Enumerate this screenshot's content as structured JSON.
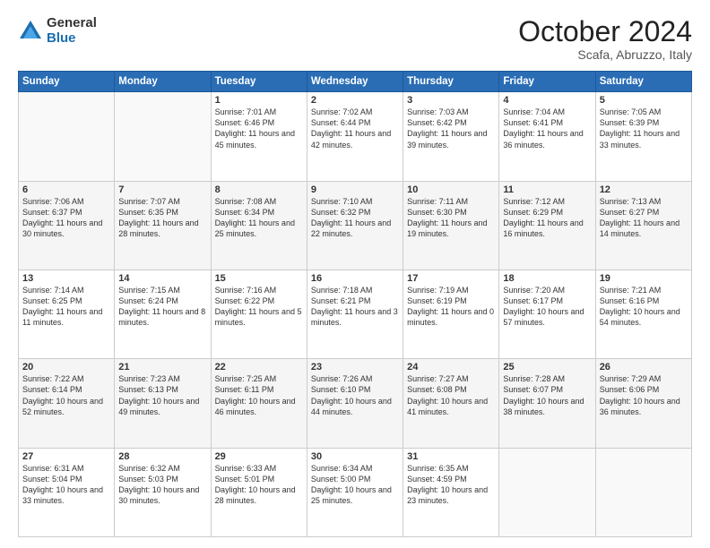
{
  "header": {
    "logo_general": "General",
    "logo_blue": "Blue",
    "month": "October 2024",
    "location": "Scafa, Abruzzo, Italy"
  },
  "weekdays": [
    "Sunday",
    "Monday",
    "Tuesday",
    "Wednesday",
    "Thursday",
    "Friday",
    "Saturday"
  ],
  "weeks": [
    [
      {
        "day": "",
        "info": ""
      },
      {
        "day": "",
        "info": ""
      },
      {
        "day": "1",
        "info": "Sunrise: 7:01 AM\nSunset: 6:46 PM\nDaylight: 11 hours and 45 minutes."
      },
      {
        "day": "2",
        "info": "Sunrise: 7:02 AM\nSunset: 6:44 PM\nDaylight: 11 hours and 42 minutes."
      },
      {
        "day": "3",
        "info": "Sunrise: 7:03 AM\nSunset: 6:42 PM\nDaylight: 11 hours and 39 minutes."
      },
      {
        "day": "4",
        "info": "Sunrise: 7:04 AM\nSunset: 6:41 PM\nDaylight: 11 hours and 36 minutes."
      },
      {
        "day": "5",
        "info": "Sunrise: 7:05 AM\nSunset: 6:39 PM\nDaylight: 11 hours and 33 minutes."
      }
    ],
    [
      {
        "day": "6",
        "info": "Sunrise: 7:06 AM\nSunset: 6:37 PM\nDaylight: 11 hours and 30 minutes."
      },
      {
        "day": "7",
        "info": "Sunrise: 7:07 AM\nSunset: 6:35 PM\nDaylight: 11 hours and 28 minutes."
      },
      {
        "day": "8",
        "info": "Sunrise: 7:08 AM\nSunset: 6:34 PM\nDaylight: 11 hours and 25 minutes."
      },
      {
        "day": "9",
        "info": "Sunrise: 7:10 AM\nSunset: 6:32 PM\nDaylight: 11 hours and 22 minutes."
      },
      {
        "day": "10",
        "info": "Sunrise: 7:11 AM\nSunset: 6:30 PM\nDaylight: 11 hours and 19 minutes."
      },
      {
        "day": "11",
        "info": "Sunrise: 7:12 AM\nSunset: 6:29 PM\nDaylight: 11 hours and 16 minutes."
      },
      {
        "day": "12",
        "info": "Sunrise: 7:13 AM\nSunset: 6:27 PM\nDaylight: 11 hours and 14 minutes."
      }
    ],
    [
      {
        "day": "13",
        "info": "Sunrise: 7:14 AM\nSunset: 6:25 PM\nDaylight: 11 hours and 11 minutes."
      },
      {
        "day": "14",
        "info": "Sunrise: 7:15 AM\nSunset: 6:24 PM\nDaylight: 11 hours and 8 minutes."
      },
      {
        "day": "15",
        "info": "Sunrise: 7:16 AM\nSunset: 6:22 PM\nDaylight: 11 hours and 5 minutes."
      },
      {
        "day": "16",
        "info": "Sunrise: 7:18 AM\nSunset: 6:21 PM\nDaylight: 11 hours and 3 minutes."
      },
      {
        "day": "17",
        "info": "Sunrise: 7:19 AM\nSunset: 6:19 PM\nDaylight: 11 hours and 0 minutes."
      },
      {
        "day": "18",
        "info": "Sunrise: 7:20 AM\nSunset: 6:17 PM\nDaylight: 10 hours and 57 minutes."
      },
      {
        "day": "19",
        "info": "Sunrise: 7:21 AM\nSunset: 6:16 PM\nDaylight: 10 hours and 54 minutes."
      }
    ],
    [
      {
        "day": "20",
        "info": "Sunrise: 7:22 AM\nSunset: 6:14 PM\nDaylight: 10 hours and 52 minutes."
      },
      {
        "day": "21",
        "info": "Sunrise: 7:23 AM\nSunset: 6:13 PM\nDaylight: 10 hours and 49 minutes."
      },
      {
        "day": "22",
        "info": "Sunrise: 7:25 AM\nSunset: 6:11 PM\nDaylight: 10 hours and 46 minutes."
      },
      {
        "day": "23",
        "info": "Sunrise: 7:26 AM\nSunset: 6:10 PM\nDaylight: 10 hours and 44 minutes."
      },
      {
        "day": "24",
        "info": "Sunrise: 7:27 AM\nSunset: 6:08 PM\nDaylight: 10 hours and 41 minutes."
      },
      {
        "day": "25",
        "info": "Sunrise: 7:28 AM\nSunset: 6:07 PM\nDaylight: 10 hours and 38 minutes."
      },
      {
        "day": "26",
        "info": "Sunrise: 7:29 AM\nSunset: 6:06 PM\nDaylight: 10 hours and 36 minutes."
      }
    ],
    [
      {
        "day": "27",
        "info": "Sunrise: 6:31 AM\nSunset: 5:04 PM\nDaylight: 10 hours and 33 minutes."
      },
      {
        "day": "28",
        "info": "Sunrise: 6:32 AM\nSunset: 5:03 PM\nDaylight: 10 hours and 30 minutes."
      },
      {
        "day": "29",
        "info": "Sunrise: 6:33 AM\nSunset: 5:01 PM\nDaylight: 10 hours and 28 minutes."
      },
      {
        "day": "30",
        "info": "Sunrise: 6:34 AM\nSunset: 5:00 PM\nDaylight: 10 hours and 25 minutes."
      },
      {
        "day": "31",
        "info": "Sunrise: 6:35 AM\nSunset: 4:59 PM\nDaylight: 10 hours and 23 minutes."
      },
      {
        "day": "",
        "info": ""
      },
      {
        "day": "",
        "info": ""
      }
    ]
  ]
}
